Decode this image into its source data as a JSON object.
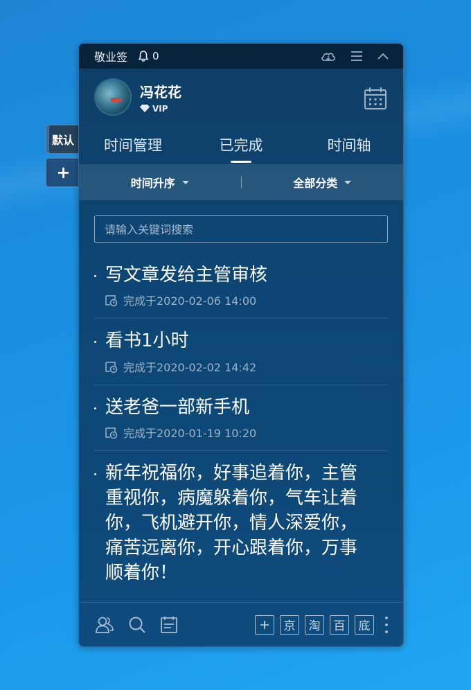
{
  "side_tabs": [
    {
      "label": "默认"
    },
    {
      "label": "+"
    }
  ],
  "titlebar": {
    "app_name": "敬业签",
    "notification_count": "0"
  },
  "user": {
    "name": "冯花花",
    "badge": "VIP"
  },
  "tabs": [
    {
      "label": "时间管理",
      "active": false
    },
    {
      "label": "已完成",
      "active": true
    },
    {
      "label": "时间轴",
      "active": false
    }
  ],
  "filters": {
    "sort": "时间升序",
    "category": "全部分类"
  },
  "search": {
    "placeholder": "请输入关键词搜索"
  },
  "items": [
    {
      "title": "写文章发给主管审核",
      "meta": "完成于2020-02-06 14:00"
    },
    {
      "title": "看书1小时",
      "meta": "完成于2020-02-02 14:42"
    },
    {
      "title": "送老爸一部新手机",
      "meta": "完成于2020-01-19 10:20"
    },
    {
      "title_lines": [
        "新年祝福你，好事追着你，主管",
        "重视你，病魔躲着你，气车让着",
        "你，飞机避开你，情人深爱你，",
        "痛苦远离你，开心跟着你，万事",
        "顺着你！"
      ]
    }
  ],
  "bottombar": {
    "buttons": [
      "京",
      "淘",
      "百",
      "底"
    ]
  },
  "colors": {
    "panel_bg": "#0e3e66",
    "titlebar_bg": "#07243c",
    "desktop": "#1b8fe0"
  }
}
